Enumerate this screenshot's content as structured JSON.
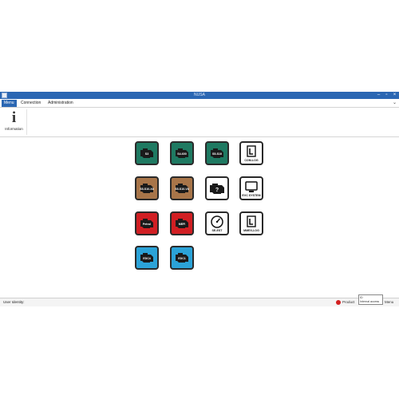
{
  "window": {
    "title": "NUSA"
  },
  "menu": {
    "items": [
      "Menu",
      "Connection",
      "Administration"
    ]
  },
  "ribbon": {
    "info_glyph": "i",
    "info_label": "Information"
  },
  "tiles": [
    {
      "label": "S3",
      "color": "green",
      "icon": "engine-icon"
    },
    {
      "label": "S4-600",
      "color": "green",
      "icon": "engine-icon"
    },
    {
      "label": "S5-S10",
      "color": "green",
      "icon": "engine-icon"
    },
    {
      "label": "COM-LOG",
      "color": "white",
      "icon": "log-book-icon"
    },
    {
      "label": "S5-S10-X8",
      "color": "brown",
      "icon": "engine-icon"
    },
    {
      "label": "S5-S10-V8",
      "color": "brown",
      "icon": "engine-icon"
    },
    {
      "label": "",
      "color": "white",
      "icon": "engine-question-icon"
    },
    {
      "label": "EVC SYSTEM",
      "color": "white",
      "icon": "monitor-icon"
    },
    {
      "label": "Petrol",
      "color": "red",
      "icon": "engine-icon"
    },
    {
      "label": "MEFI",
      "color": "red",
      "icon": "engine-icon"
    },
    {
      "label": "SE-EST",
      "color": "white",
      "icon": "gauge-icon"
    },
    {
      "label": "MMEX-LOG",
      "color": "white",
      "icon": "log-book-icon"
    },
    {
      "label": "EDC4",
      "color": "blue",
      "icon": "engine-icon"
    },
    {
      "label": "EDC1",
      "color": "blue",
      "icon": "engine-icon"
    }
  ],
  "status": {
    "user_identity": "User Identity:",
    "product": "Product",
    "id_box_line1": "ID",
    "id_box_line2": "Internal access",
    "trailing": "Menu"
  },
  "colors": {
    "titlebar": "#2b67b3",
    "green": "#1f7a62",
    "brown": "#a87549",
    "red": "#d11f23",
    "blue": "#2ba3d8",
    "status_dot": "#d32020"
  }
}
